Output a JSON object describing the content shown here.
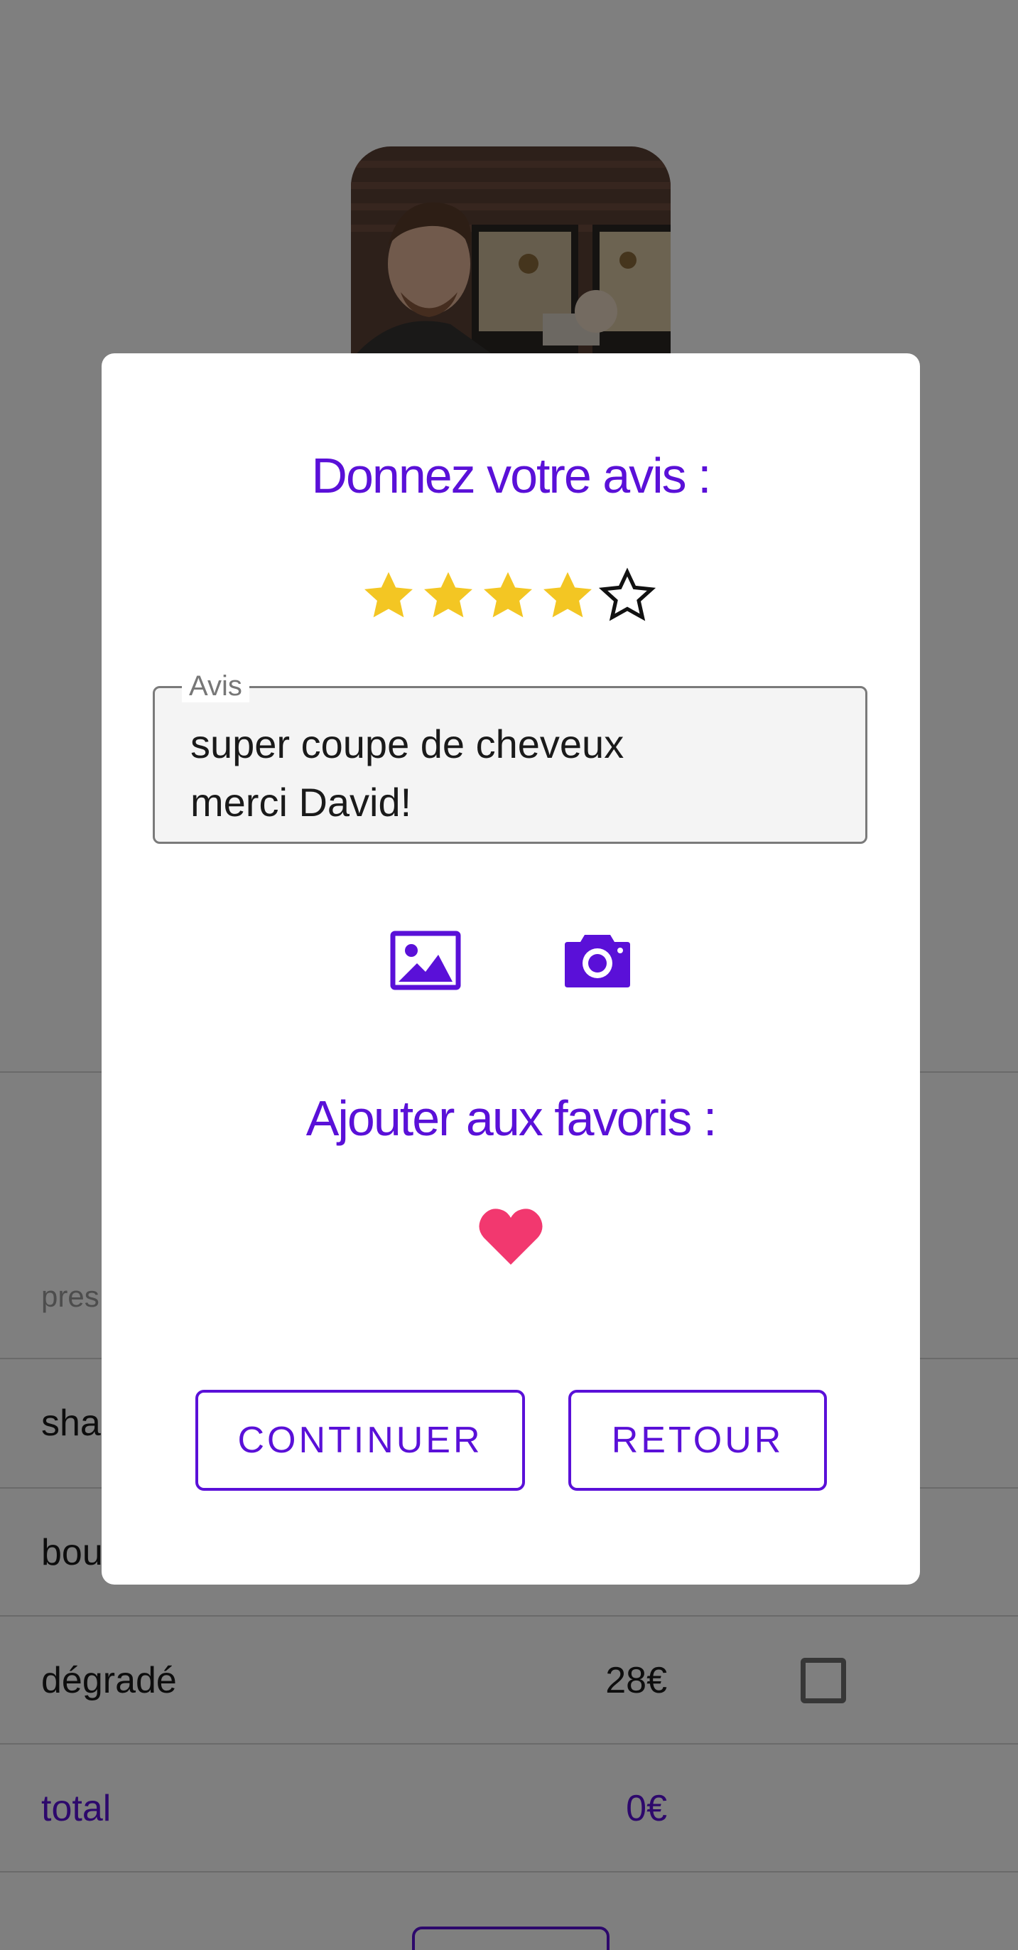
{
  "modal": {
    "title": "Donnez votre avis :",
    "rating": {
      "value": 4,
      "max": 5
    },
    "review": {
      "label": "Avis",
      "value": "super coupe de cheveux\nmerci David!"
    },
    "media": {
      "gallery_icon": "image-icon",
      "camera_icon": "camera-icon"
    },
    "favorites": {
      "title": "Ajouter aux favoris :",
      "icon": "heart-icon",
      "active": true
    },
    "buttons": {
      "continue_label": "CONTINUER",
      "back_label": "RETOUR"
    }
  },
  "background": {
    "services_header": "pres",
    "rows": [
      {
        "name": "sha",
        "price": ""
      },
      {
        "name": "bou",
        "price": ""
      },
      {
        "name": "dégradé",
        "price": "28€"
      }
    ],
    "total_label": "total",
    "total_value": "0€"
  },
  "colors": {
    "accent": "#5a10d8",
    "star": "#f3c623",
    "heart": "#f2386f",
    "overlay": "rgba(0,0,0,0.5)"
  }
}
